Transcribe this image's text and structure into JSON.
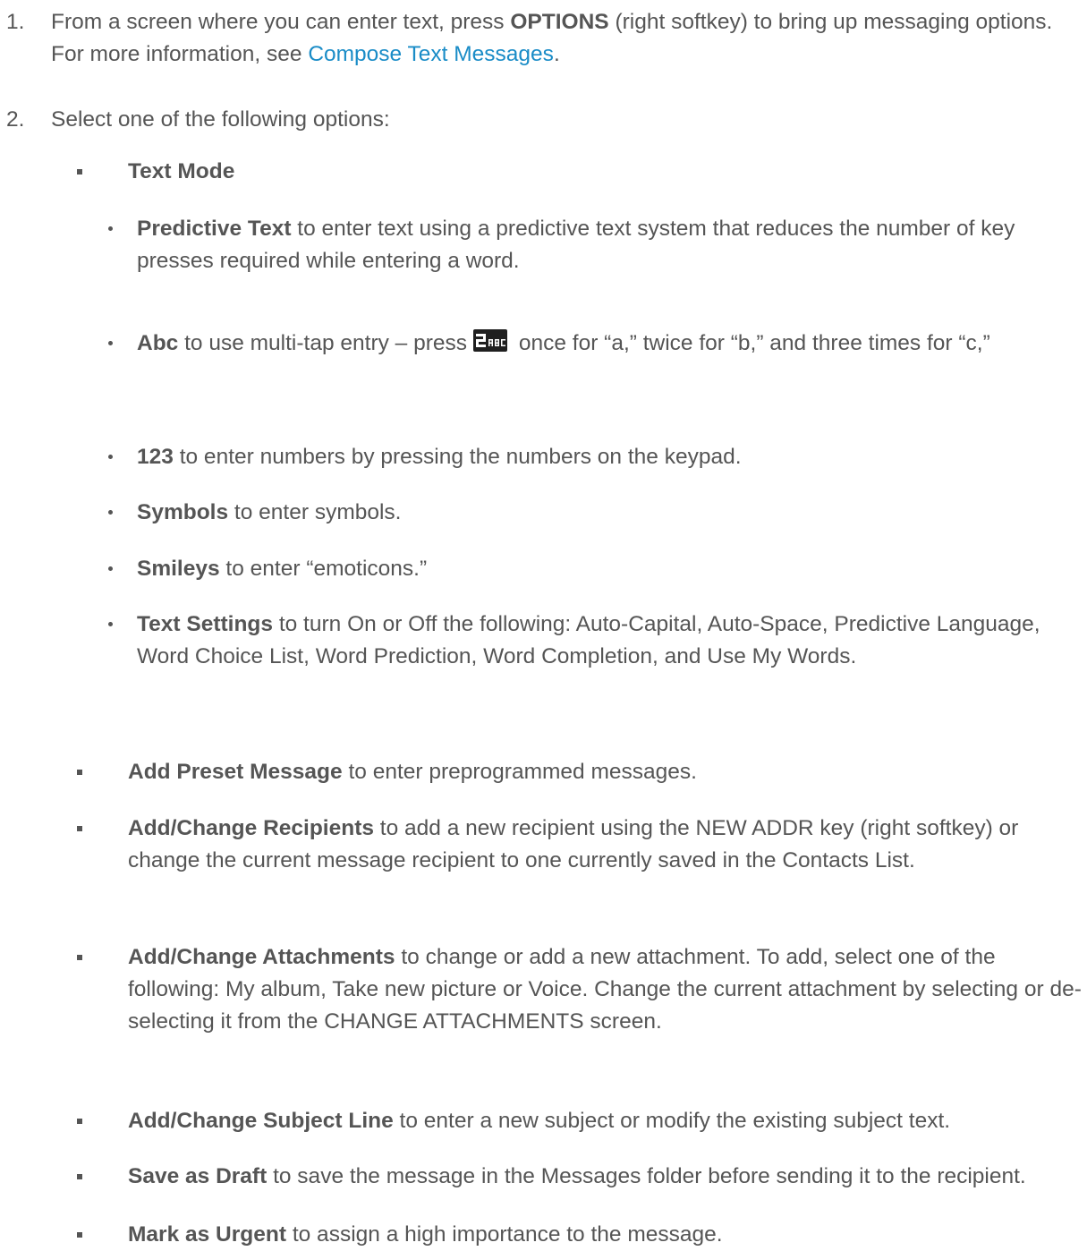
{
  "steps": [
    {
      "num": "1.",
      "pre": "From a screen where you can enter text, press ",
      "bold": "OPTIONS",
      "mid": " (right softkey) to bring up messaging options. For more information, see ",
      "link": "Compose Text Messages",
      "post": "."
    },
    {
      "num": "2.",
      "text": "Select one of the following options:"
    }
  ],
  "text_mode": {
    "title": "Text Mode",
    "items": [
      {
        "bold": "Predictive Text",
        "text": " to enter text using a predictive text system that reduces the number of key presses required while entering a word."
      },
      {
        "bold": "Abc",
        "text_pre": " to use multi-tap entry – press",
        "icon": "key-2-abc-icon",
        "icon_text": "2 ABC",
        "text_post": " once for “a,” twice for “b,” and three times for “c,”"
      },
      {
        "bold": "123",
        "text": " to enter numbers by pressing the numbers on the keypad."
      },
      {
        "bold": "Symbols",
        "text": " to enter symbols."
      },
      {
        "bold": "Smileys",
        "text": " to enter “emoticons.”"
      },
      {
        "bold": "Text Settings",
        "text": " to turn On or Off the following: Auto-Capital, Auto-Space, Predictive Language, Word Choice List, Word Prediction, Word Completion, and Use My Words."
      }
    ]
  },
  "options": [
    {
      "bold": "Add Preset Message",
      "text": " to enter preprogrammed messages."
    },
    {
      "bold": "Add/Change Recipients",
      "text": " to add a new recipient using the NEW ADDR key (right softkey) or change the current message recipient to one currently saved in the Contacts List."
    },
    {
      "bold": "Add/Change Attachments",
      "text": " to change or add a new attachment. To add, select one of the following: My album, Take new picture or Voice. Change the current attachment by selecting or de-selecting it from the CHANGE ATTACHMENTS screen."
    },
    {
      "bold": "Add/Change Subject Line",
      "text": " to enter a new subject or modify the existing subject text."
    },
    {
      "bold": "Save as Draft",
      "text": " to save the message in the Messages folder before sending it to the recipient."
    },
    {
      "bold": "Mark as Urgent",
      "text": " to assign a high importance to the message."
    }
  ],
  "colors": {
    "text": "#555555",
    "link": "#1a8cc7",
    "key_bg": "#1f1f1f"
  }
}
